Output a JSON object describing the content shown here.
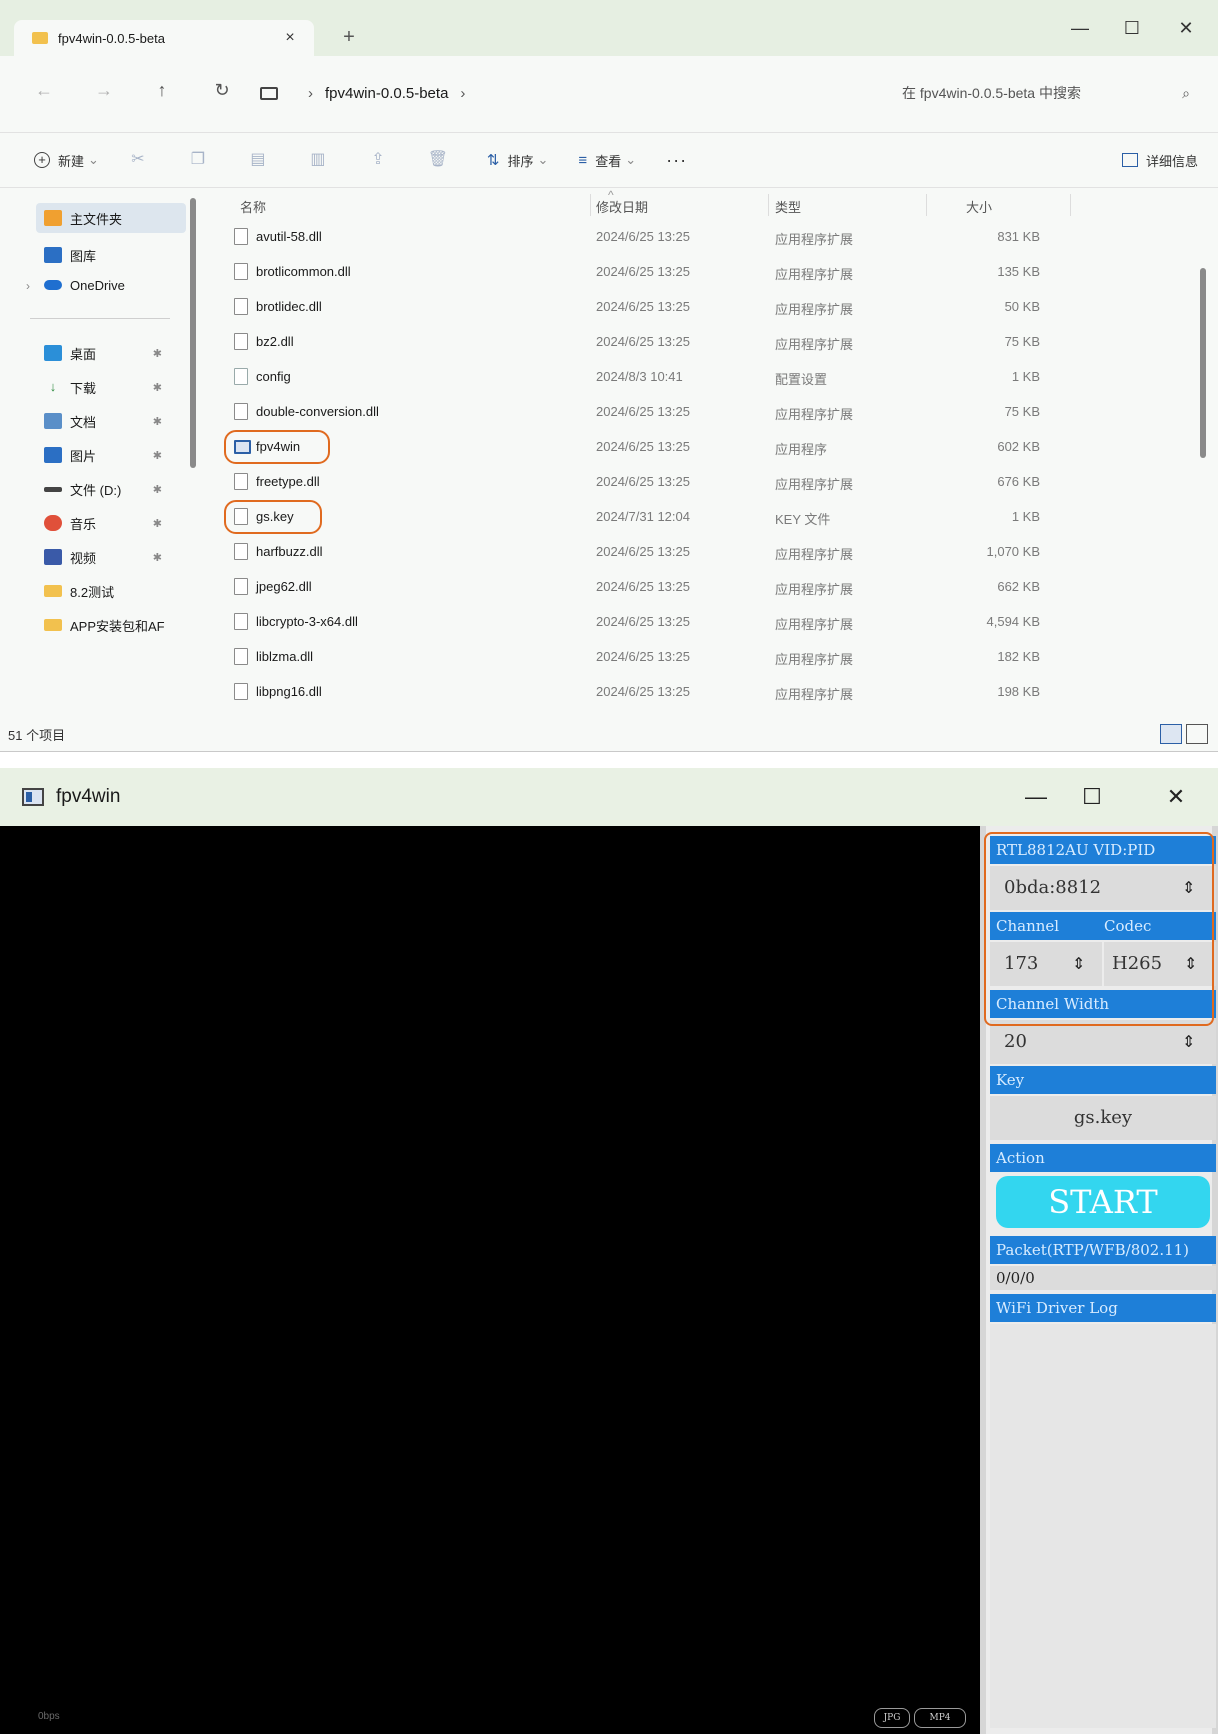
{
  "explorer": {
    "tab_title": "fpv4win-0.0.5-beta",
    "breadcrumb": [
      "fpv4win-0.0.5-beta"
    ],
    "search_placeholder": "在 fpv4win-0.0.5-beta 中搜索",
    "toolbar": {
      "new_label": "新建",
      "sort_label": "排序",
      "view_label": "查看",
      "more_label": "···",
      "details_label": "详细信息"
    },
    "nav": {
      "home": "主文件夹",
      "gallery": "图库",
      "onedrive": "OneDrive",
      "quick": [
        {
          "label": "桌面"
        },
        {
          "label": "下载"
        },
        {
          "label": "文档"
        },
        {
          "label": "图片"
        },
        {
          "label": "文件 (D:)"
        },
        {
          "label": "音乐"
        },
        {
          "label": "视频"
        },
        {
          "label": "8.2测试"
        },
        {
          "label": "APP安装包和AF"
        }
      ]
    },
    "columns": {
      "name": "名称",
      "date": "修改日期",
      "type": "类型",
      "size": "大小"
    },
    "files": [
      {
        "name": "avutil-58.dll",
        "date": "2024/6/25 13:25",
        "type": "应用程序扩展",
        "size": "831 KB",
        "kind": "dll"
      },
      {
        "name": "brotlicommon.dll",
        "date": "2024/6/25 13:25",
        "type": "应用程序扩展",
        "size": "135 KB",
        "kind": "dll"
      },
      {
        "name": "brotlidec.dll",
        "date": "2024/6/25 13:25",
        "type": "应用程序扩展",
        "size": "50 KB",
        "kind": "dll"
      },
      {
        "name": "bz2.dll",
        "date": "2024/6/25 13:25",
        "type": "应用程序扩展",
        "size": "75 KB",
        "kind": "dll"
      },
      {
        "name": "config",
        "date": "2024/8/3 10:41",
        "type": "配置设置",
        "size": "1 KB",
        "kind": "cfg"
      },
      {
        "name": "double-conversion.dll",
        "date": "2024/6/25 13:25",
        "type": "应用程序扩展",
        "size": "75 KB",
        "kind": "dll"
      },
      {
        "name": "fpv4win",
        "date": "2024/6/25 13:25",
        "type": "应用程序",
        "size": "602 KB",
        "kind": "app",
        "highlighted": true
      },
      {
        "name": "freetype.dll",
        "date": "2024/6/25 13:25",
        "type": "应用程序扩展",
        "size": "676 KB",
        "kind": "dll"
      },
      {
        "name": "gs.key",
        "date": "2024/7/31 12:04",
        "type": "KEY 文件",
        "size": "1 KB",
        "kind": "key",
        "highlighted": true
      },
      {
        "name": "harfbuzz.dll",
        "date": "2024/6/25 13:25",
        "type": "应用程序扩展",
        "size": "1,070 KB",
        "kind": "dll"
      },
      {
        "name": "jpeg62.dll",
        "date": "2024/6/25 13:25",
        "type": "应用程序扩展",
        "size": "662 KB",
        "kind": "dll"
      },
      {
        "name": "libcrypto-3-x64.dll",
        "date": "2024/6/25 13:25",
        "type": "应用程序扩展",
        "size": "4,594 KB",
        "kind": "dll"
      },
      {
        "name": "liblzma.dll",
        "date": "2024/6/25 13:25",
        "type": "应用程序扩展",
        "size": "182 KB",
        "kind": "dll"
      },
      {
        "name": "libpng16.dll",
        "date": "2024/6/25 13:25",
        "type": "应用程序扩展",
        "size": "198 KB",
        "kind": "dll"
      }
    ],
    "status_count": "51 个项目"
  },
  "fpv": {
    "title": "fpv4win",
    "vidpid_header": "RTL8812AU VID:PID",
    "vidpid_value": "0bda:8812",
    "channel_header": "Channel",
    "codec_header": "Codec",
    "channel_value": "173",
    "codec_value": "H265",
    "width_header": "Channel Width",
    "width_value": "20",
    "key_header": "Key",
    "key_value": "gs.key",
    "action_header": "Action",
    "start_label": "START",
    "packet_header": "Packet(RTP/WFB/802.11)",
    "packet_value": "0/0/0",
    "log_header": "WiFi Driver Log",
    "bitrate": "0bps",
    "jpg_label": "JPG",
    "mp4_label": "MP4"
  },
  "colors": {
    "accent_blue": "#1e7fd8",
    "start_cyan": "#33d6ef",
    "highlight_orange": "#e06a1f"
  }
}
